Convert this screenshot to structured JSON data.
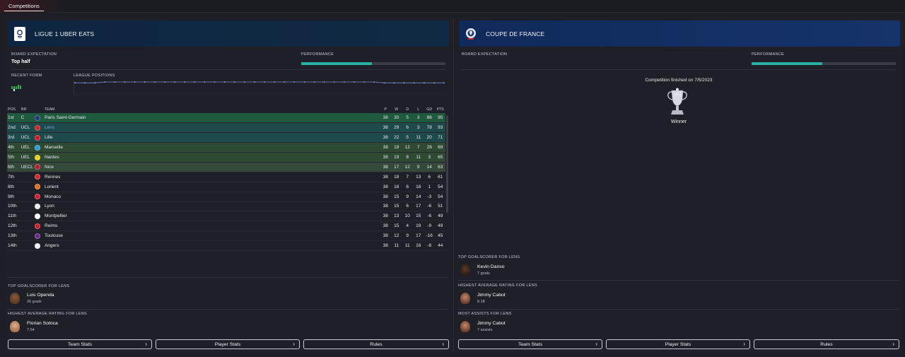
{
  "top_tab": "Competitions",
  "left": {
    "title": "LIGUE 1 UBER EATS",
    "board_expectation_label": "BOARD EXPECTATION",
    "board_expectation_value": "Top half",
    "performance_label": "PERFORMANCE",
    "performance_fill": 0.49,
    "recent_form_label": "RECENT FORM",
    "league_positions_label": "LEAGUE POSITIONS",
    "table": {
      "headers": [
        "POS",
        "INF",
        "TEAM",
        "P",
        "W",
        "D",
        "L",
        "GD",
        "PTS"
      ],
      "rows": [
        {
          "pos": "1st",
          "inf": "C",
          "team": "Paris Saint-Germain",
          "p": "38",
          "w": "30",
          "d": "5",
          "l": "3",
          "gd": "86",
          "pts": "95",
          "zone": "champion",
          "crest": "#1d3a7a"
        },
        {
          "pos": "2nd",
          "inf": "UCL",
          "team": "Lens",
          "p": "38",
          "w": "29",
          "d": "6",
          "l": "3",
          "gd": "78",
          "pts": "93",
          "zone": "ucl",
          "crest": "#c8282a",
          "highlight": true
        },
        {
          "pos": "3rd",
          "inf": "UCL",
          "team": "Lille",
          "p": "38",
          "w": "22",
          "d": "5",
          "l": "11",
          "gd": "20",
          "pts": "71",
          "zone": "ucl",
          "crest": "#c81e2a"
        },
        {
          "pos": "4th",
          "inf": "UEL",
          "team": "Marseille",
          "p": "38",
          "w": "19",
          "d": "12",
          "l": "7",
          "gd": "28",
          "pts": "69",
          "zone": "uel",
          "crest": "#2b9bd6"
        },
        {
          "pos": "5th",
          "inf": "UEL",
          "team": "Nantes",
          "p": "38",
          "w": "19",
          "d": "8",
          "l": "11",
          "gd": "3",
          "pts": "65",
          "zone": "uel",
          "crest": "#e8d020"
        },
        {
          "pos": "6th",
          "inf": "UECL",
          "team": "Nice",
          "p": "38",
          "w": "17",
          "d": "12",
          "l": "9",
          "gd": "14",
          "pts": "63",
          "zone": "uecl",
          "crest": "#b0202a"
        },
        {
          "pos": "7th",
          "inf": "",
          "team": "Rennes",
          "p": "38",
          "w": "18",
          "d": "7",
          "l": "13",
          "gd": "6",
          "pts": "61",
          "zone": "",
          "crest": "#d02a2a"
        },
        {
          "pos": "8th",
          "inf": "",
          "team": "Lorient",
          "p": "38",
          "w": "16",
          "d": "6",
          "l": "16",
          "gd": "1",
          "pts": "54",
          "zone": "",
          "crest": "#e07020"
        },
        {
          "pos": "9th",
          "inf": "",
          "team": "Monaco",
          "p": "38",
          "w": "15",
          "d": "9",
          "l": "14",
          "gd": "-3",
          "pts": "54",
          "zone": "",
          "crest": "#d02030"
        },
        {
          "pos": "10th",
          "inf": "",
          "team": "Lyon",
          "p": "38",
          "w": "15",
          "d": "6",
          "l": "17",
          "gd": "-6",
          "pts": "51",
          "zone": "",
          "crest": "#e8e8ee"
        },
        {
          "pos": "11th",
          "inf": "",
          "team": "Montpellier",
          "p": "38",
          "w": "13",
          "d": "10",
          "l": "15",
          "gd": "-6",
          "pts": "49",
          "zone": "",
          "crest": "#ffffff"
        },
        {
          "pos": "12th",
          "inf": "",
          "team": "Reims",
          "p": "38",
          "w": "15",
          "d": "4",
          "l": "19",
          "gd": "-9",
          "pts": "49",
          "zone": "",
          "crest": "#c81e2a"
        },
        {
          "pos": "13th",
          "inf": "",
          "team": "Toulouse",
          "p": "38",
          "w": "12",
          "d": "9",
          "l": "17",
          "gd": "-16",
          "pts": "45",
          "zone": "",
          "crest": "#6a2a8a"
        },
        {
          "pos": "14th",
          "inf": "",
          "team": "Angers",
          "p": "38",
          "w": "11",
          "d": "11",
          "l": "16",
          "gd": "-8",
          "pts": "44",
          "zone": "",
          "crest": "#f0f0f4"
        }
      ]
    },
    "top_goalscorer_label": "TOP GOALSCORER FOR LENS",
    "top_goalscorer_name": "Lois Openda",
    "top_goalscorer_sub": "26 goals",
    "highest_rating_label": "HIGHEST AVERAGE RATING FOR LENS",
    "highest_rating_name": "Florian Sotoca",
    "highest_rating_sub": "7.64",
    "buttons": [
      "Team Stats",
      "Player Stats",
      "Rules"
    ]
  },
  "right": {
    "title": "COUPE DE FRANCE",
    "board_expectation_label": "BOARD EXPECTATION",
    "performance_label": "PERFORMANCE",
    "performance_fill": 0.49,
    "finished_text": "Competition finished on 7/5/2023",
    "result": "Winner",
    "top_goalscorer_label": "TOP GOALSCORER FOR LENS",
    "top_goalscorer_name": "Kevin Danso",
    "top_goalscorer_sub": "7 goals",
    "highest_rating_label": "HIGHEST AVERAGE RATING FOR LENS",
    "highest_rating_name": "Jimmy Cabot",
    "highest_rating_sub": "8.18",
    "most_assists_label": "MOST ASSISTS FOR LENS",
    "most_assists_name": "Jimmy Cabot",
    "most_assists_sub": "7 assists",
    "buttons": [
      "Team Stats",
      "Player Stats",
      "Rules"
    ]
  },
  "colors": {
    "accent_teal": "#2bb0a4",
    "champion_row": "#1f5a3e",
    "ucl_row": "#1f4a4c",
    "uel_row": "#2f4a33",
    "uecl_row": "#34493a",
    "lens_text": "#6fa6e8"
  },
  "icons": {
    "ligue1_logo": "ligue1-logo-icon",
    "cdf_logo": "coupe-de-france-logo-icon",
    "trophy": "trophy-icon",
    "chevron": "chevron-right-icon"
  }
}
